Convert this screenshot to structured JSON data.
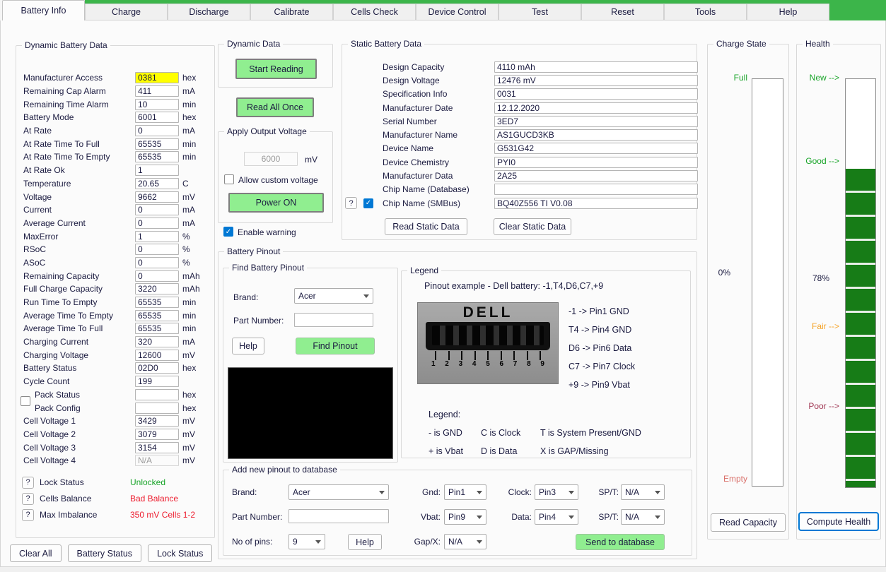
{
  "colors": {
    "tab_strip_green": "#3cb54a",
    "button_green": "#90ee90",
    "highlight_yellow": "#ffff00",
    "checkbox_blue": "#0078d4",
    "health_bar_green": "#177c17",
    "status_green": "#18a428",
    "status_red": "#ed1c2e",
    "fair_orange": "#f5a42a",
    "poor_maroon": "#a23a56",
    "empty_rose": "#d9706a"
  },
  "tabs": [
    {
      "label": "Battery Info",
      "cls": "active"
    },
    {
      "label": "Charge"
    },
    {
      "label": "Discharge"
    },
    {
      "label": "Calibrate"
    },
    {
      "label": "Cells Check"
    },
    {
      "label": "Device Control"
    },
    {
      "label": "Test"
    },
    {
      "label": "Reset"
    },
    {
      "label": "Tools"
    },
    {
      "label": "Help"
    }
  ],
  "dynamic_battery_data": {
    "title": "Dynamic Battery Data",
    "rows": [
      {
        "label": "Manufacturer Access",
        "value": "0381",
        "unit": "hex",
        "cls": "hl"
      },
      {
        "label": "Remaining Cap Alarm",
        "value": "411",
        "unit": "mA"
      },
      {
        "label": "Remaining Time Alarm",
        "value": "10",
        "unit": "min"
      },
      {
        "label": "Battery Mode",
        "value": "6001",
        "unit": "hex"
      },
      {
        "label": "At Rate",
        "value": "0",
        "unit": "mA"
      },
      {
        "label": "At Rate Time To Full",
        "value": "65535",
        "unit": "min"
      },
      {
        "label": "At Rate Time To Empty",
        "value": "65535",
        "unit": "min"
      },
      {
        "label": "At Rate Ok",
        "value": "1",
        "unit": ""
      },
      {
        "label": "Temperature",
        "value": "20.65",
        "unit": "C"
      },
      {
        "label": "Voltage",
        "value": "9662",
        "unit": "mV"
      },
      {
        "label": "Current",
        "value": "0",
        "unit": "mA"
      },
      {
        "label": "Average Current",
        "value": "0",
        "unit": "mA"
      },
      {
        "label": "MaxError",
        "value": "1",
        "unit": "%"
      },
      {
        "label": "RSoC",
        "value": "0",
        "unit": "%"
      },
      {
        "label": "ASoC",
        "value": "0",
        "unit": "%"
      },
      {
        "label": "Remaining Capacity",
        "value": "0",
        "unit": "mAh"
      },
      {
        "label": "Full Charge Capacity",
        "value": "3220",
        "unit": "mAh"
      },
      {
        "label": "Run Time To Empty",
        "value": "65535",
        "unit": "min"
      },
      {
        "label": "Average Time To Empty",
        "value": "65535",
        "unit": "min"
      },
      {
        "label": "Average Time To Full",
        "value": "65535",
        "unit": "min"
      },
      {
        "label": "Charging Current",
        "value": "320",
        "unit": "mA"
      },
      {
        "label": "Charging Voltage",
        "value": "12600",
        "unit": "mV"
      },
      {
        "label": "Battery Status",
        "value": "02D0",
        "unit": "hex"
      },
      {
        "label": "Cycle Count",
        "value": "199",
        "unit": ""
      }
    ],
    "pack": {
      "checked": false,
      "status_label": "Pack Status",
      "status_value": "",
      "status_unit": "hex",
      "config_label": "Pack Config",
      "config_value": "",
      "config_unit": "hex"
    },
    "cell_rows": [
      {
        "label": "Cell Voltage 1",
        "value": "3429",
        "unit": "mV"
      },
      {
        "label": "Cell Voltage 2",
        "value": "3079",
        "unit": "mV"
      },
      {
        "label": "Cell Voltage 3",
        "value": "3154",
        "unit": "mV"
      },
      {
        "label": "Cell Voltage 4",
        "value": "N/A",
        "unit": "mV",
        "cls": "dis"
      }
    ],
    "indicators": [
      {
        "q": "?",
        "label": "Lock Status",
        "value": "Unlocked",
        "color": "c-green"
      },
      {
        "q": "?",
        "label": "Cells Balance",
        "value": "Bad Balance",
        "color": "c-red"
      },
      {
        "q": "?",
        "label": "Max Imbalance",
        "value": "350 mV Cells 1-2",
        "color": "c-red"
      }
    ]
  },
  "left_buttons": [
    {
      "label": "Clear All"
    },
    {
      "label": "Battery Status"
    },
    {
      "label": "Lock Status"
    }
  ],
  "dynamic_data": {
    "title": "Dynamic Data",
    "start_button": "Start Reading",
    "read_all_button": "Read All Once"
  },
  "apply_output_voltage": {
    "title": "Apply Output Voltage",
    "voltage_value": "6000",
    "voltage_unit": "mV",
    "allow_custom_label": "Allow custom voltage",
    "allow_custom_checked": false,
    "power_button": "Power ON"
  },
  "enable_warning": {
    "label": "Enable warning",
    "checked": true
  },
  "static_battery_data": {
    "title": "Static Battery Data",
    "rows": [
      {
        "label": "Design Capacity",
        "value": "4110 mAh"
      },
      {
        "label": "Design Voltage",
        "value": "12476 mV"
      },
      {
        "label": "Specification Info",
        "value": "0031"
      },
      {
        "label": "Manufacturer Date",
        "value": "12.12.2020"
      },
      {
        "label": "Serial Number",
        "value": "3ED7"
      },
      {
        "label": "Manufacturer Name",
        "value": "AS1GUCD3KB"
      },
      {
        "label": "Device Name",
        "value": "G531G42"
      },
      {
        "label": "Device Chemistry",
        "value": "PYI0"
      },
      {
        "label": "Manufacturer Data",
        "value": "2A25"
      },
      {
        "label": "Chip Name (Database)",
        "value": ""
      }
    ],
    "smbus_row": {
      "q": "?",
      "checked": true,
      "label": "Chip Name (SMBus)",
      "value": "BQ40Z556 TI V0.08"
    },
    "read_button": "Read Static Data",
    "clear_button": "Clear Static Data"
  },
  "battery_pinout": {
    "title": "Battery Pinout",
    "find": {
      "title": "Find Battery Pinout",
      "brand_label": "Brand:",
      "brand_value": "Acer",
      "part_label": "Part Number:",
      "part_value": "",
      "help_button": "Help",
      "find_button": "Find Pinout"
    },
    "legend": {
      "title": "Legend",
      "example": "Pinout example - Dell battery:  -1,T4,D6,C7,+9",
      "photo_brand": "DELL",
      "pin_numbers": [
        "1",
        "2",
        "3",
        "4",
        "5",
        "6",
        "7",
        "8",
        "9"
      ],
      "mappings": [
        "-1 -> Pin1 GND",
        "T4 -> Pin4 GND",
        "D6 -> Pin6 Data",
        "C7 -> Pin7 Clock",
        "+9 -> Pin9 Vbat"
      ],
      "legend_label": "Legend:",
      "legend_rows": [
        {
          "c1": "- is GND",
          "c2": "C is Clock",
          "c3": "T is System Present/GND"
        },
        {
          "c1": "+ is Vbat",
          "c2": "D is Data",
          "c3": "X is GAP/Missing"
        }
      ]
    },
    "add": {
      "title": "Add new pinout to database",
      "brand_label": "Brand:",
      "brand_value": "Acer",
      "part_label": "Part Number:",
      "part_value": "",
      "pins_label": "No of pins:",
      "pins_value": "9",
      "help_button": "Help",
      "gnd_label": "Gnd:",
      "gnd_value": "Pin1",
      "clock_label": "Clock:",
      "clock_value": "Pin3",
      "spt1_label": "SP/T:",
      "spt1_value": "N/A",
      "vbat_label": "Vbat:",
      "vbat_value": "Pin9",
      "data_label": "Data:",
      "data_value": "Pin4",
      "spt2_label": "SP/T:",
      "spt2_value": "N/A",
      "gap_label": "Gap/X:",
      "gap_value": "N/A",
      "send_button": "Send to database"
    }
  },
  "charge_state": {
    "title": "Charge State",
    "top_label": "Full",
    "percent": "0%",
    "bottom_label": "Empty",
    "button": "Read Capacity",
    "fill_percent": 0
  },
  "health": {
    "title": "Health",
    "new_label": "New -->",
    "good_label": "Good -->",
    "percent": "78%",
    "fair_label": "Fair -->",
    "poor_label": "Poor -->",
    "button": "Compute Health",
    "fill_percent": 78
  }
}
